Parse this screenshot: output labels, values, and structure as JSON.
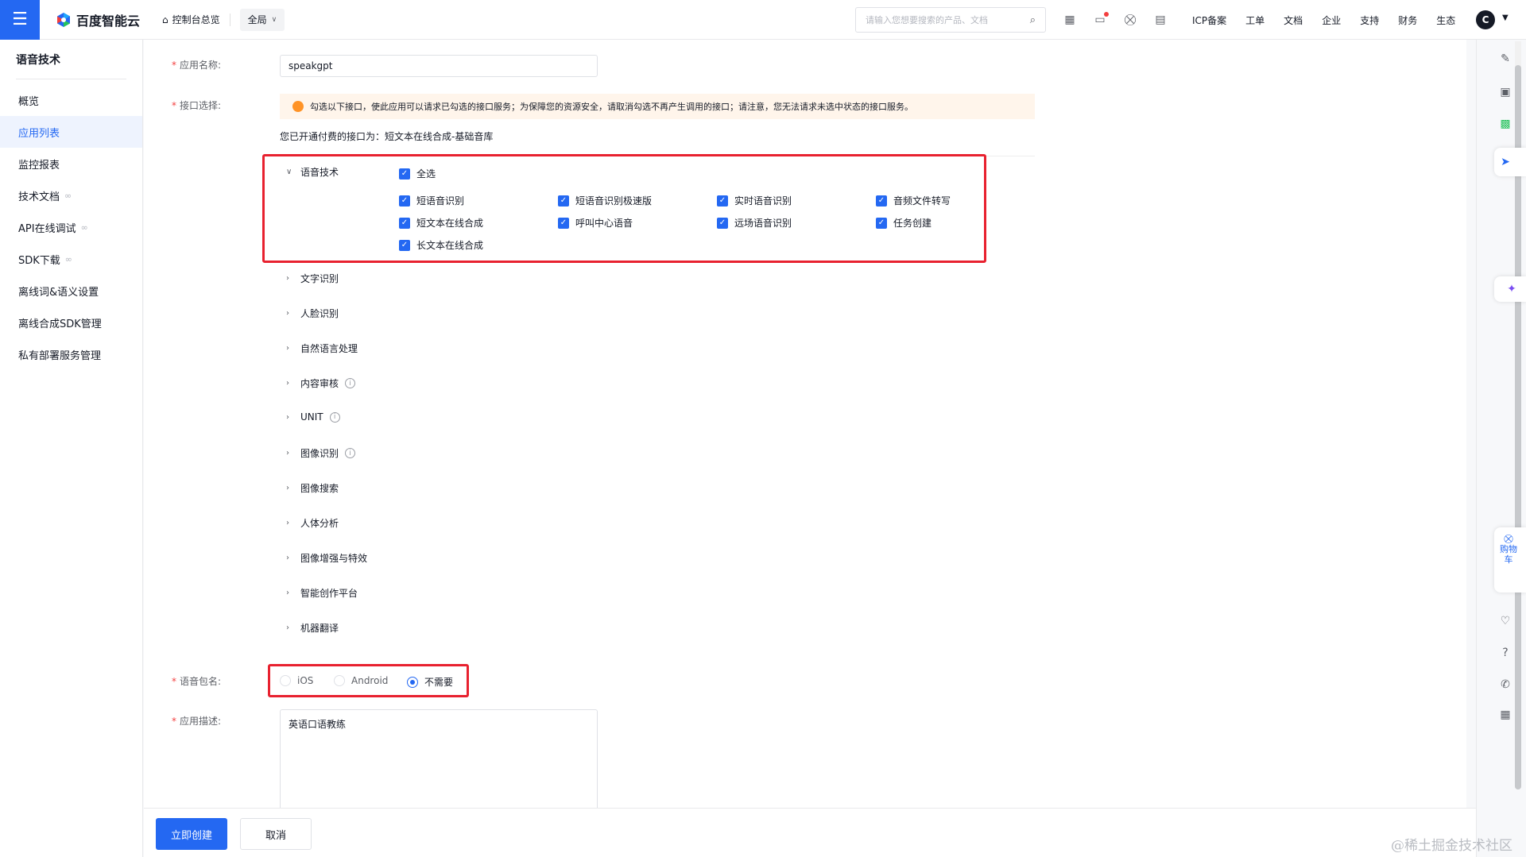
{
  "topbar": {
    "brand": "百度智能云",
    "home_label": "控制台总览",
    "region": "全局",
    "search_placeholder": "请输入您想要搜索的产品、文档",
    "links": [
      "ICP备案",
      "工单",
      "文档",
      "企业",
      "支持",
      "财务",
      "生态"
    ],
    "avatar_letter": "C"
  },
  "sidebar": {
    "title": "语音技术",
    "items": [
      {
        "label": "概览",
        "active": false,
        "external": false
      },
      {
        "label": "应用列表",
        "active": true,
        "external": false
      },
      {
        "label": "监控报表",
        "active": false,
        "external": false
      },
      {
        "label": "技术文档",
        "active": false,
        "external": true
      },
      {
        "label": "API在线调试",
        "active": false,
        "external": true
      },
      {
        "label": "SDK下载",
        "active": false,
        "external": true
      },
      {
        "label": "离线词&语义设置",
        "active": false,
        "external": false
      },
      {
        "label": "离线合成SDK管理",
        "active": false,
        "external": false
      },
      {
        "label": "私有部署服务管理",
        "active": false,
        "external": false
      }
    ]
  },
  "form": {
    "app_name_label": "应用名称:",
    "app_name_value": "speakgpt",
    "api_select_label": "接口选择:",
    "notice": "勾选以下接口，使此应用可以请求已勾选的接口服务；为保障您的资源安全，请取消勾选不再产生调用的接口；请注意，您无法请求未选中状态的接口服务。",
    "paid_line": "您已开通付费的接口为：短文本在线合成-基础音库",
    "speech_group": {
      "title": "语音技术",
      "select_all": "全选",
      "items": [
        "短语音识别",
        "短语音识别极速版",
        "实时语音识别",
        "音频文件转写",
        "短文本在线合成",
        "呼叫中心语音",
        "远场语音识别",
        "任务创建",
        "长文本在线合成"
      ]
    },
    "collapsed_groups": [
      {
        "title": "文字识别",
        "info": false
      },
      {
        "title": "人脸识别",
        "info": false
      },
      {
        "title": "自然语言处理",
        "info": false
      },
      {
        "title": "内容审核",
        "info": true
      },
      {
        "title": "UNIT",
        "info": true
      },
      {
        "title": "图像识别",
        "info": true
      },
      {
        "title": "图像搜索",
        "info": false
      },
      {
        "title": "人体分析",
        "info": false
      },
      {
        "title": "图像增强与特效",
        "info": false
      },
      {
        "title": "智能创作平台",
        "info": false
      },
      {
        "title": "机器翻译",
        "info": false
      }
    ],
    "package_label": "语音包名:",
    "package_options": [
      "iOS",
      "Android",
      "不需要"
    ],
    "package_selected": "不需要",
    "desc_label": "应用描述:",
    "desc_value": "英语口语教练"
  },
  "footer": {
    "create_label": "立即创建",
    "cancel_label": "取消"
  },
  "rail": {
    "cart_label": "购物车"
  },
  "watermark": "@稀土掘金技术社区",
  "colors": {
    "primary": "#2468f2",
    "highlight_box": "#e8212f",
    "notice_bg": "#fff5eb",
    "notice_icon": "#ff9326"
  }
}
